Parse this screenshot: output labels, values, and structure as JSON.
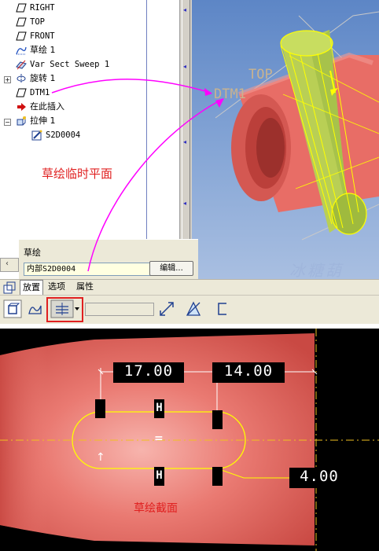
{
  "model_tree": {
    "items": [
      {
        "label": "RIGHT",
        "icon": "datum-plane-icon"
      },
      {
        "label": "TOP",
        "icon": "datum-plane-icon"
      },
      {
        "label": "FRONT",
        "icon": "datum-plane-icon"
      },
      {
        "label": "草绘 1",
        "icon": "sketch-icon"
      },
      {
        "label": "Var Sect Sweep 1",
        "icon": "sweep-icon"
      },
      {
        "label": "旋转 1",
        "icon": "revolve-icon"
      },
      {
        "label": "DTM1",
        "icon": "datum-plane-icon"
      },
      {
        "label": "在此插入",
        "icon": "insert-here-arrow-icon"
      },
      {
        "label": "拉伸 1",
        "icon": "extrude-icon"
      },
      {
        "label": "S2D0004",
        "icon": "sketch-edit-icon"
      }
    ]
  },
  "viewport": {
    "datum_labels": {
      "top": "TOP",
      "dtm1": "DTM1"
    },
    "watermark": "冰糖葫"
  },
  "annotations": {
    "temporary_plane": "草绘临时平面",
    "sketch_section": "草绘截面"
  },
  "sketch_panel": {
    "title": "草绘",
    "field_value": "内部S2D0004",
    "edit_button": "编辑..."
  },
  "tabs": [
    {
      "label": "放置",
      "active": true
    },
    {
      "label": "选项",
      "active": false
    },
    {
      "label": "属性",
      "active": false
    }
  ],
  "toolbar": {
    "buttons": [
      "solid-icon",
      "surface-icon",
      "depth-option-icon",
      "flip-direction-icon",
      "remove-material-icon",
      "thicken-icon"
    ]
  },
  "sketch_view": {
    "dimensions": [
      "17.00",
      "14.00",
      "4.00"
    ],
    "constraints": [
      "H",
      "H",
      "=",
      "↑"
    ]
  },
  "colors": {
    "accent_arrow": "#ff00ff",
    "annotation_red": "#e02020",
    "model_pink": "#e9706a",
    "highlight_yellow": "#ffff00"
  }
}
